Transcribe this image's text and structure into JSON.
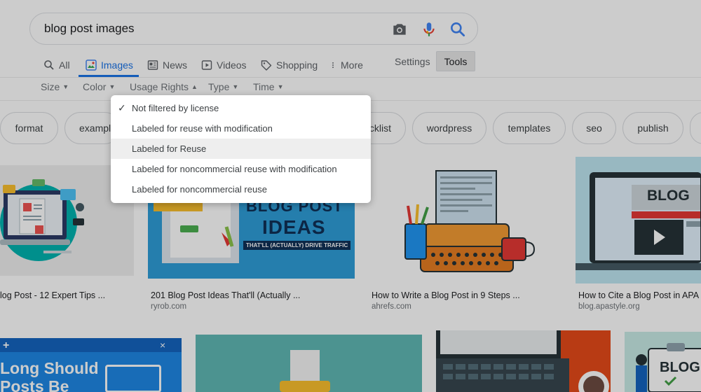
{
  "search": {
    "query": "blog post images"
  },
  "tabs": [
    {
      "label": "All",
      "icon": "search-icon"
    },
    {
      "label": "Images",
      "icon": "image-icon",
      "active": true
    },
    {
      "label": "News",
      "icon": "news-icon"
    },
    {
      "label": "Videos",
      "icon": "play-icon"
    },
    {
      "label": "Shopping",
      "icon": "tag-icon"
    },
    {
      "label": "More",
      "icon": "more-vert-icon"
    }
  ],
  "nav_right": {
    "settings": "Settings",
    "tools": "Tools"
  },
  "filters": [
    "Size",
    "Color",
    "Usage Rights",
    "Type",
    "Time"
  ],
  "chips": [
    "format",
    "exampl",
    "cklist",
    "wordpress",
    "templates",
    "seo",
    "publish"
  ],
  "usage_menu": {
    "items": [
      "Not filtered by license",
      "Labeled for reuse with modification",
      "Labeled for Reuse",
      "Labeled for noncommercial reuse with modification",
      "Labeled for noncommercial reuse"
    ],
    "checked_index": 0,
    "highlighted_index": 2
  },
  "results": [
    {
      "caption": "log Post - 12 Expert Tips ...",
      "source": ""
    },
    {
      "caption": "201 Blog Post Ideas That'll (Actually ...",
      "source": "ryrob.com"
    },
    {
      "caption": "How to Write a Blog Post in 9 Steps ...",
      "source": "ahrefs.com"
    },
    {
      "caption": "How to Cite a Blog Post in APA S",
      "source": "blog.apastyle.org"
    }
  ],
  "image_text": {
    "ideas_title": "BLOG POST",
    "ideas_word": "IDEAS",
    "ideas_sub": "THAT'LL (ACTUALLY) DRIVE TRAFFIC",
    "blog_sign": "BLOG",
    "long_should_1": "Long Should",
    "long_should_2": "Posts Be",
    "blog_sign2": "BLOG"
  },
  "colors": {
    "accent": "#1a73e8",
    "mic_red": "#ea4335",
    "mic_yellow": "#fbbc04",
    "mic_green": "#34a853"
  }
}
